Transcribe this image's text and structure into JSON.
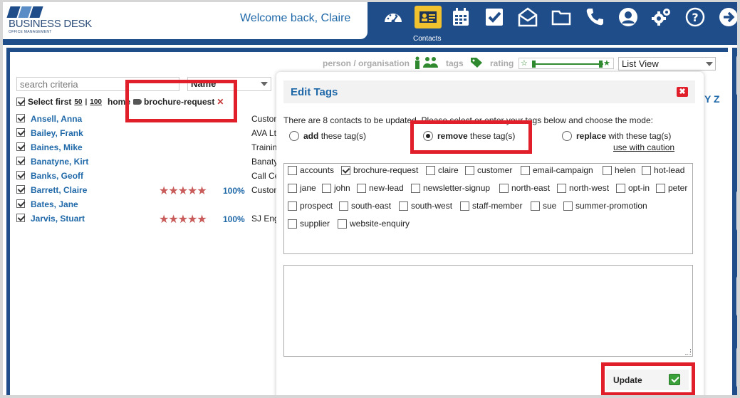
{
  "header": {
    "logo_name": "BUSINESS DESK",
    "logo_sub": "OFFICE MANAGEMENT",
    "welcome": "Welcome back, Claire",
    "nav": [
      {
        "icon": "dashboard-icon"
      },
      {
        "icon": "contacts-icon",
        "label": "Contacts",
        "active": true
      },
      {
        "icon": "calendar-icon"
      },
      {
        "icon": "tasks-icon"
      },
      {
        "icon": "mail-icon"
      },
      {
        "icon": "folder-icon"
      },
      {
        "icon": "phone-icon"
      },
      {
        "icon": "user-icon"
      },
      {
        "icon": "settings-icon"
      },
      {
        "icon": "help-icon"
      },
      {
        "icon": "logout-icon"
      }
    ]
  },
  "toolbar": {
    "person_org": "person / organisation",
    "tags": "tags",
    "rating": "rating",
    "view_select": "List View"
  },
  "filters": {
    "search_placeholder": "search criteria",
    "sort": "Name",
    "select_first": "Select first",
    "opt50": "50",
    "sep": "|",
    "opt100": "100",
    "home": "home",
    "active_tag": "brochure-request",
    "alpha": "Y Z"
  },
  "contacts": [
    {
      "name": "Ansell, Anna",
      "org": "Customer",
      "checked": true
    },
    {
      "name": "Bailey, Frank",
      "org": "AVA Ltd",
      "checked": true
    },
    {
      "name": "Baines, Mike",
      "org": "Training",
      "checked": true
    },
    {
      "name": "Banatyne, Kirt",
      "org": "Banatyne",
      "checked": true
    },
    {
      "name": "Banks, Geoff",
      "org": "Call Centre",
      "checked": true
    },
    {
      "name": "Barrett, Claire",
      "org": "Customer",
      "checked": true,
      "stars": "★★★★★",
      "pct": "100%"
    },
    {
      "name": "Bates, Jane",
      "org": "",
      "checked": true
    },
    {
      "name": "Jarvis, Stuart",
      "org": "SJ Engineering",
      "checked": true,
      "stars": "★★★★★",
      "pct": "100%"
    }
  ],
  "modal": {
    "title": "Edit Tags",
    "close": "✖",
    "description": "There are 8 contacts to be updated. Please select or enter your tags below and choose the mode:",
    "modes": [
      {
        "bold": "add",
        "rest": "these tag(s)",
        "selected": false
      },
      {
        "bold": "remove",
        "rest": "these tag(s)",
        "selected": true
      },
      {
        "bold": "replace",
        "rest": "with these tag(s)",
        "selected": false
      }
    ],
    "caution": "use with caution",
    "tags": [
      {
        "label": "accounts",
        "checked": false
      },
      {
        "label": "brochure-request",
        "checked": true
      },
      {
        "label": "claire",
        "checked": false
      },
      {
        "label": "customer",
        "checked": false
      },
      {
        "label": "email-campaign",
        "checked": false
      },
      {
        "label": "helen",
        "checked": false
      },
      {
        "label": "hot-lead",
        "checked": false
      },
      {
        "label": "jane",
        "checked": false
      },
      {
        "label": "john",
        "checked": false
      },
      {
        "label": "new-lead",
        "checked": false
      },
      {
        "label": "newsletter-signup",
        "checked": false
      },
      {
        "label": "north-east",
        "checked": false
      },
      {
        "label": "north-west",
        "checked": false
      },
      {
        "label": "opt-in",
        "checked": false
      },
      {
        "label": "peter",
        "checked": false
      },
      {
        "label": "prospect",
        "checked": false
      },
      {
        "label": "south-east",
        "checked": false
      },
      {
        "label": "south-west",
        "checked": false
      },
      {
        "label": "staff-member",
        "checked": false
      },
      {
        "label": "sue",
        "checked": false
      },
      {
        "label": "summer-promotion",
        "checked": false
      },
      {
        "label": "supplier",
        "checked": false
      },
      {
        "label": "website-enquiry",
        "checked": false
      }
    ],
    "textarea_value": "",
    "update_label": "Update"
  }
}
